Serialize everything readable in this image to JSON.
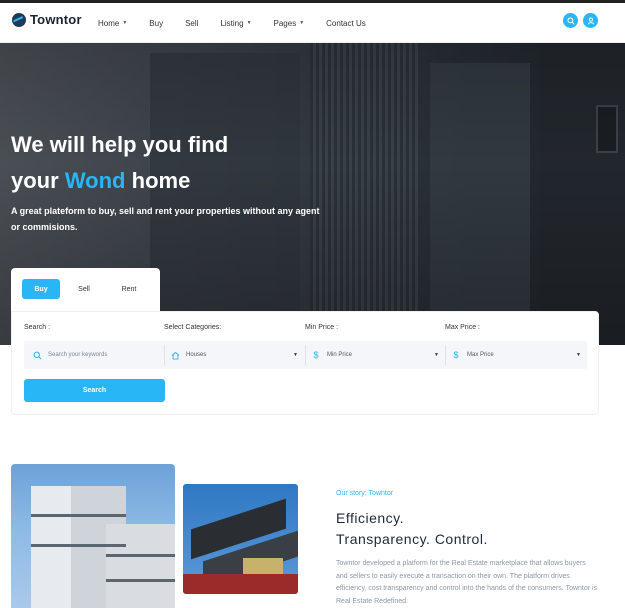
{
  "header": {
    "logo": "Towntor",
    "nav": [
      {
        "label": "Home",
        "caret": true
      },
      {
        "label": "Buy",
        "caret": false
      },
      {
        "label": "Sell",
        "caret": false
      },
      {
        "label": "Listing",
        "caret": true
      },
      {
        "label": "Pages",
        "caret": true
      },
      {
        "label": "Contact Us",
        "caret": false
      }
    ],
    "icons": [
      "search-icon",
      "user-icon"
    ],
    "accent": "#29b6f6"
  },
  "hero": {
    "title_line1": "We will help you find",
    "title_pre": "your",
    "title_accent": "Wond",
    "title_post": "home",
    "subtitle": "A great plateform to buy, sell and rent your properties without any agent or commisions."
  },
  "search": {
    "tabs": [
      "Buy",
      "Sell",
      "Rent"
    ],
    "active_tab": "Buy",
    "labels": {
      "search": "Search :",
      "category": "Select Categories:",
      "min_price": "Min Price :",
      "max_price": "Max Price :"
    },
    "search_placeholder": "Search your keywords",
    "category_value": "Houses",
    "min_price_value": "Min Price",
    "max_price_value": "Max Price",
    "button": "Search"
  },
  "story": {
    "kicker": "Our story: Towntor",
    "title_line1": "Efficiency.",
    "title_line2": "Transparency. Control.",
    "text": "Towntor developed a platform for the Real Estate marketplace that allows buyers and sellers to easily execute a transaction on their own. The platform drives efficiency, cost transparency and control into the hands of the consumers. Towntor is Real Estate Redefined."
  }
}
